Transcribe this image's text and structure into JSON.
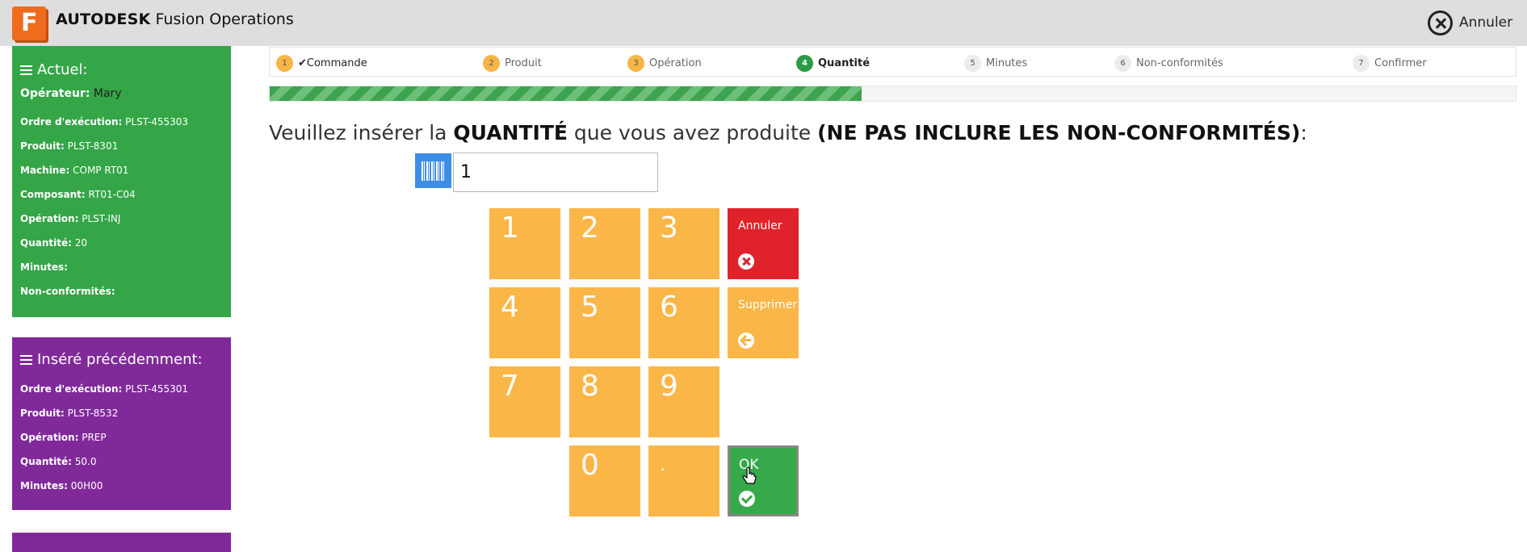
{
  "header": {
    "logo_letter": "F",
    "brand_bold": "AUTODESK",
    "brand_rest": " Fusion Operations",
    "cancel_label": "Annuler"
  },
  "current": {
    "title": "Actuel:",
    "operator_label": "Opérateur:",
    "operator_value": "Mary",
    "rows": [
      {
        "label": "Ordre d'exécution:",
        "value": "PLST-455303"
      },
      {
        "label": "Produit:",
        "value": "PLST-8301"
      },
      {
        "label": "Machine:",
        "value": "COMP RT01"
      },
      {
        "label": "Composant:",
        "value": "RT01-C04"
      },
      {
        "label": "Opération:",
        "value": "PLST-INJ"
      },
      {
        "label": "Quantité:",
        "value": "20"
      },
      {
        "label": "Minutes:",
        "value": ""
      },
      {
        "label": "Non-conformités:",
        "value": ""
      }
    ]
  },
  "previous": {
    "title": "Inséré précédemment:",
    "rows": [
      {
        "label": "Ordre d'exécution:",
        "value": "PLST-455301"
      },
      {
        "label": "Produit:",
        "value": "PLST-8532"
      },
      {
        "label": "Opération:",
        "value": "PREP"
      },
      {
        "label": "Quantité:",
        "value": "50.0"
      },
      {
        "label": "Minutes:",
        "value": "00H00"
      }
    ]
  },
  "steps": [
    {
      "num": "1",
      "label": "✔Commande",
      "state": "done"
    },
    {
      "num": "2",
      "label": "Produit",
      "state": "done"
    },
    {
      "num": "3",
      "label": "Opération",
      "state": "done"
    },
    {
      "num": "4",
      "label": "Quantité",
      "state": "active"
    },
    {
      "num": "5",
      "label": "Minutes",
      "state": "todo"
    },
    {
      "num": "6",
      "label": "Non-conformités",
      "state": "todo"
    },
    {
      "num": "7",
      "label": "Confirmer",
      "state": "todo"
    }
  ],
  "progress_percent": 47.5,
  "prompt": {
    "part1": "Veuillez insérer la ",
    "part2": "QUANTITÉ",
    "part3": " que vous avez produite ",
    "part4": "(NE PAS INCLURE LES NON-CONFORMITÉS)",
    "part5": ":"
  },
  "input": {
    "value": "1"
  },
  "keypad": {
    "digits": [
      "1",
      "2",
      "3",
      "4",
      "5",
      "6",
      "7",
      "8",
      "9",
      "0",
      "."
    ],
    "cancel_label": "Annuler",
    "delete_label": "Supprimer",
    "ok_label": "OK"
  },
  "colors": {
    "orange": "#fbb648",
    "green": "#36a94a",
    "purple": "#802a9a",
    "red": "#e0222a"
  }
}
